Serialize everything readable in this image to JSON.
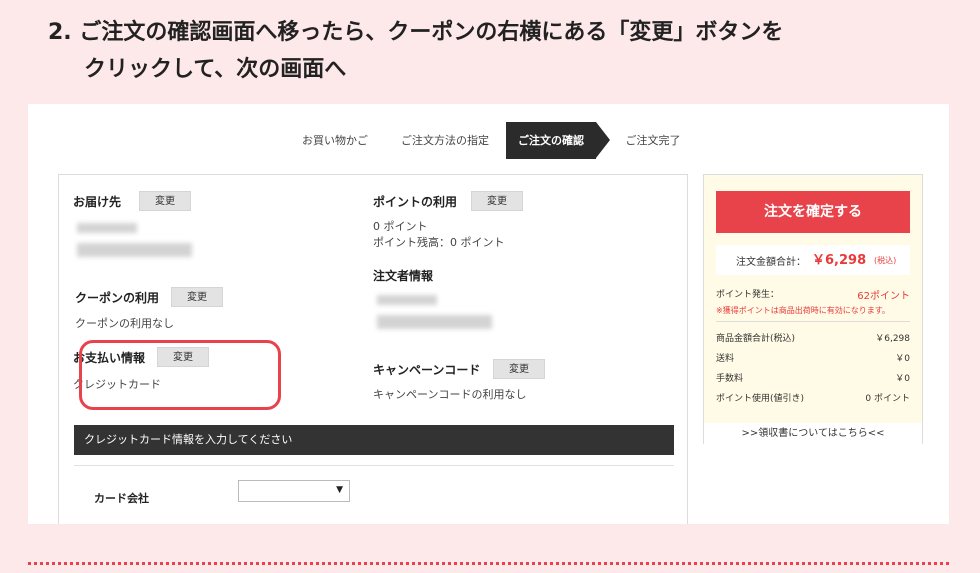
{
  "instruction": {
    "line1": "2. ご注文の確認画面へ移ったら、クーポンの右横にある「変更」ボタンを",
    "line2": "クリックして、次の画面へ"
  },
  "steps": [
    {
      "label": "お買い物かご"
    },
    {
      "label": "ご注文方法の指定"
    },
    {
      "label": "ご注文の確認"
    },
    {
      "label": "ご注文完了"
    }
  ],
  "left": {
    "delivery_title": "お届け先",
    "change_label": "変更",
    "coupon_title": "クーポンの利用",
    "coupon_value": "クーポンの利用なし",
    "payment_title": "お支払い情報",
    "payment_value": "クレジットカード"
  },
  "middle": {
    "points_title": "ポイントの利用",
    "points_line1": "0 ポイント",
    "points_line2": "ポイント残高：0 ポイント",
    "orderer_title": "注文者情報",
    "campaign_title": "キャンペーンコード",
    "campaign_value": "キャンペーンコードの利用なし"
  },
  "card": {
    "bar_title": "クレジットカード情報を入力してください",
    "company_label": "カード会社",
    "select_arrow": "▼"
  },
  "side": {
    "confirm_label": "注文を確定する",
    "total_label": "注文金額合計：",
    "total_value": "￥6,298",
    "total_tax": "(税込)",
    "points_earn_label": "ポイント発生：",
    "points_earn_value": "62ポイント",
    "note": "※獲得ポイントは商品出荷時に有効になります。",
    "rows": [
      {
        "label": "商品金額合計(税込)",
        "value": "￥6,298"
      },
      {
        "label": "送料",
        "value": "￥0"
      },
      {
        "label": "手数料",
        "value": "￥0"
      },
      {
        "label": "ポイント使用(値引き)",
        "value": "0 ポイント"
      }
    ],
    "receipt_link": ">>領収書についてはこちら<<"
  },
  "colors": {
    "page_bg": "#fde8ea",
    "accent": "#e8424a",
    "highlight_circle": "#e8434d",
    "active_step": "#2b2b2b"
  }
}
